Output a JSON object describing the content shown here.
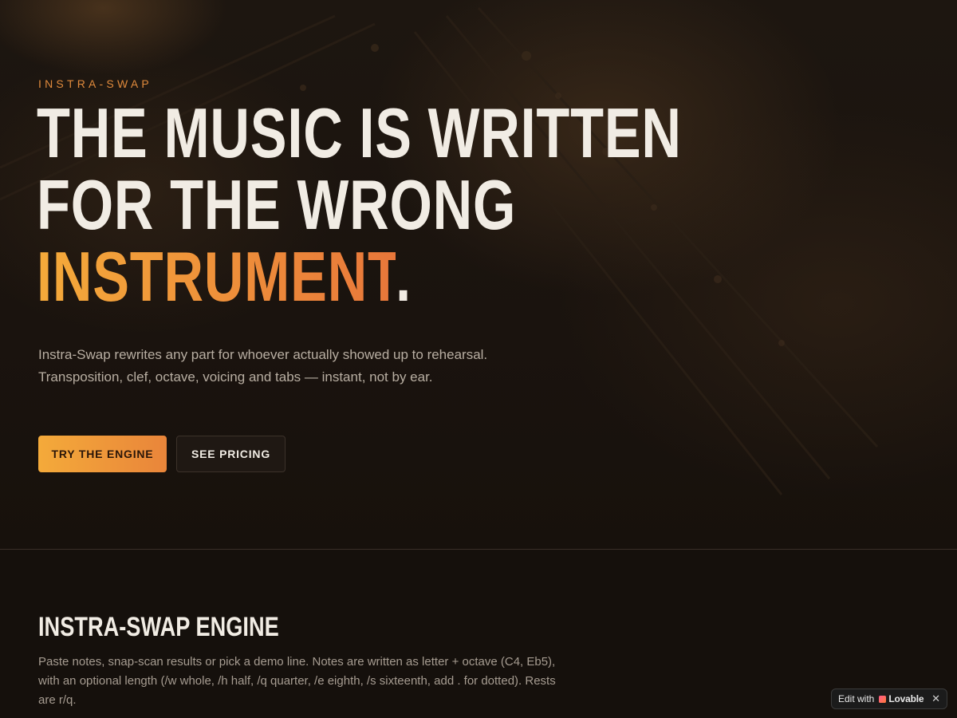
{
  "hero": {
    "eyebrow": "INSTRA-SWAP",
    "headline_line1": "THE MUSIC IS WRITTEN",
    "headline_line2": "FOR THE WRONG",
    "headline_accent": "INSTRUMENT",
    "headline_period": ".",
    "lede": "Instra-Swap rewrites any part for whoever actually showed up to rehearsal. Transposition, clef, octave, voicing and tabs — instant, not by ear.",
    "primary_button": "TRY THE ENGINE",
    "secondary_button": "SEE PRICING"
  },
  "engine": {
    "title": "INSTRA-SWAP ENGINE",
    "description": "Paste notes, snap-scan results or pick a demo line. Notes are written as letter + octave (C4, Eb5), with an optional length (/w whole, /h half, /q quarter, /e eighth, /s sixteenth, add . for dotted). Rests are r/q."
  },
  "badge": {
    "prefix": "Edit with",
    "brand": "Lovable",
    "close": "✕",
    "heart_icon": "heart-icon"
  },
  "colors": {
    "accent_start": "#f4aa3a",
    "accent_end": "#e8773a",
    "background": "#15100c"
  }
}
